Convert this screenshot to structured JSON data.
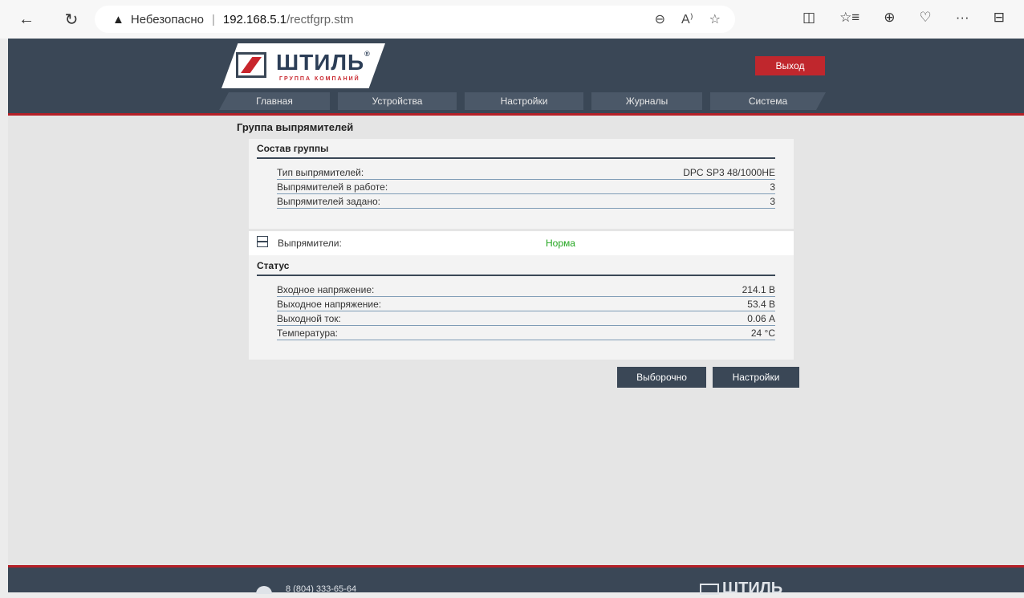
{
  "browser": {
    "back_icon": "←",
    "refresh_icon": "↻",
    "warning_icon": "▲",
    "security_label": "Небезопасно",
    "host": "192.168.5.1",
    "path": "/rectfgrp.stm",
    "zoom_icon": "⊖",
    "read_aloud_icon": "A⁾",
    "favorite_icon": "☆",
    "toolbar_icons": [
      "◫",
      "☆≡",
      "⊕",
      "♡",
      "···",
      "⊟"
    ]
  },
  "header": {
    "logo_text": "ШТИЛЬ",
    "logo_reg": "®",
    "logo_sub": "ГРУППА КОМПАНИЙ",
    "exit_label": "Выход",
    "nav": [
      {
        "label": "Главная"
      },
      {
        "label": "Устройства"
      },
      {
        "label": "Настройки"
      },
      {
        "label": "Журналы"
      },
      {
        "label": "Система"
      }
    ]
  },
  "main": {
    "title": "Группа выпрямителей",
    "composition": {
      "heading": "Состав группы",
      "rows": [
        {
          "label": "Тип выпрямителей:",
          "value": "DPC SP3 48/1000HE"
        },
        {
          "label": "Выпрямителей в работе:",
          "value": "3"
        },
        {
          "label": "Выпрямителей задано:",
          "value": "3"
        }
      ]
    },
    "rectifiers": {
      "label": "Выпрямители:",
      "value": "Норма",
      "status_heading": "Статус",
      "rows": [
        {
          "label": "Входное напряжение:",
          "value": "214.1 В"
        },
        {
          "label": "Выходное напряжение:",
          "value": "53.4 В"
        },
        {
          "label": "Выходной ток:",
          "value": "0.06 А"
        },
        {
          "label": "Температура:",
          "value": "24 °С"
        }
      ]
    },
    "buttons": {
      "selective": "Выборочно",
      "settings": "Настройки"
    }
  },
  "footer": {
    "phone": "8 (804) 333-65-64",
    "logo_text": "ШТИЛЬ"
  }
}
